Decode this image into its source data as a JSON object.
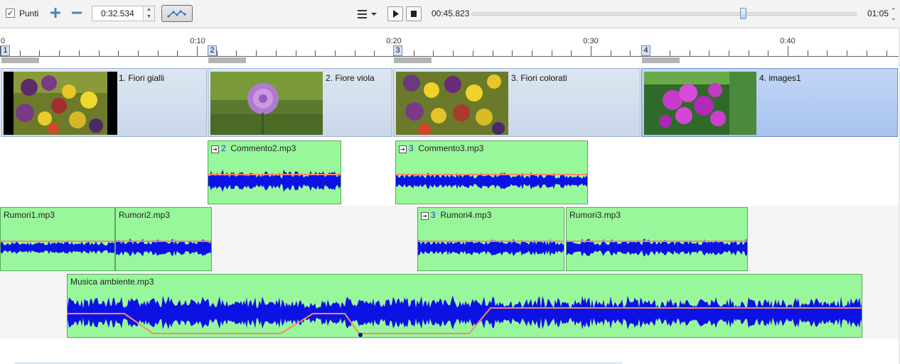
{
  "toolbar": {
    "points_checked": true,
    "points_label": "Punti",
    "time_value": "0:32.534",
    "current_time": "00:45.823",
    "total_time": "01:05",
    "seek_progress": 0.705
  },
  "ruler": {
    "labels": [
      "0",
      "0:10",
      "0:20",
      "0:30",
      "0:40"
    ]
  },
  "slides": [
    {
      "number": "1",
      "title": "1. Fiori gialli"
    },
    {
      "number": "2",
      "title": "2. Fiore viola"
    },
    {
      "number": "3",
      "title": "3. Fiori colorati"
    },
    {
      "number": "4",
      "title": "4. images1"
    }
  ],
  "comment_clips": [
    {
      "num": "2",
      "name": "Commento2.mp3"
    },
    {
      "num": "3",
      "name": "Commento3.mp3"
    }
  ],
  "noise_clips": [
    {
      "name": "Rumori1.mp3"
    },
    {
      "name": "Rumori2.mp3"
    },
    {
      "num": "3",
      "name": "Rumori4.mp3"
    },
    {
      "name": "Rumori3.mp3"
    }
  ],
  "music_clip": {
    "name": "Musica ambiente.mp3"
  },
  "colors": {
    "clip_fill": "#99f79b",
    "waveform": "#0d12e4",
    "volume_line": "#f08a6c",
    "slide_selected": "#a8c3ee"
  }
}
